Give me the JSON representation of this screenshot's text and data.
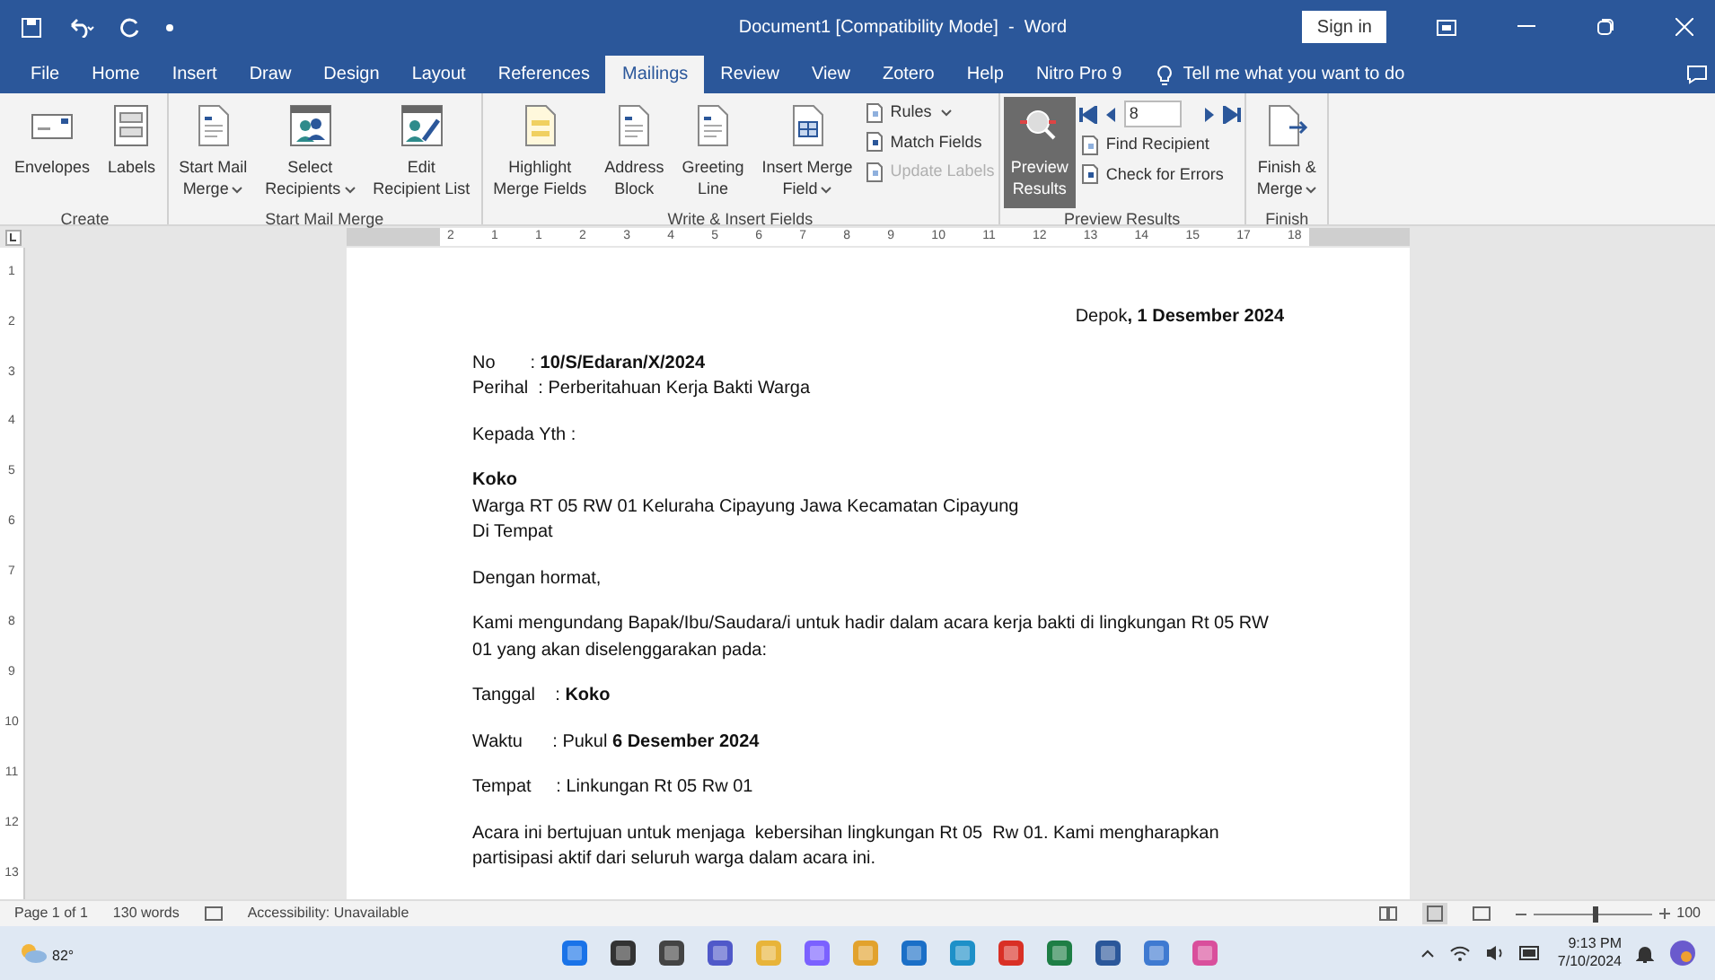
{
  "window": {
    "title": "Document1 [Compatibility Mode]  -  Word",
    "sign_in": "Sign in"
  },
  "tabs": [
    {
      "label": "File",
      "selected": false
    },
    {
      "label": "Home",
      "selected": false
    },
    {
      "label": "Insert",
      "selected": false
    },
    {
      "label": "Draw",
      "selected": false
    },
    {
      "label": "Design",
      "selected": false
    },
    {
      "label": "Layout",
      "selected": false
    },
    {
      "label": "References",
      "selected": false
    },
    {
      "label": "Mailings",
      "selected": true
    },
    {
      "label": "Review",
      "selected": false
    },
    {
      "label": "View",
      "selected": false
    },
    {
      "label": "Zotero",
      "selected": false
    },
    {
      "label": "Help",
      "selected": false
    },
    {
      "label": "Nitro Pro 9",
      "selected": false
    }
  ],
  "tell_me": "Tell me what you want to do",
  "ribbon": [
    {
      "group": "Create",
      "items": [
        {
          "kind": "large",
          "lines": [
            "Envelopes"
          ],
          "dropdown": false,
          "selected": false
        },
        {
          "kind": "large",
          "lines": [
            "Labels"
          ],
          "dropdown": false,
          "selected": false
        }
      ]
    },
    {
      "group": "Start Mail Merge",
      "items": [
        {
          "kind": "large",
          "lines": [
            "Start Mail",
            "Merge"
          ],
          "dropdown": true,
          "selected": false
        },
        {
          "kind": "large",
          "lines": [
            "Select",
            "Recipients"
          ],
          "dropdown": true,
          "selected": false
        },
        {
          "kind": "large",
          "lines": [
            "Edit",
            "Recipient List"
          ],
          "dropdown": false,
          "selected": false
        }
      ]
    },
    {
      "group": "Write & Insert Fields",
      "items": [
        {
          "kind": "large",
          "lines": [
            "Highlight",
            "Merge Fields"
          ],
          "dropdown": false,
          "selected": false
        },
        {
          "kind": "large",
          "lines": [
            "Address",
            "Block"
          ],
          "dropdown": false,
          "selected": false
        },
        {
          "kind": "large",
          "lines": [
            "Greeting",
            "Line"
          ],
          "dropdown": false,
          "selected": false
        },
        {
          "kind": "large",
          "lines": [
            "Insert Merge",
            "Field"
          ],
          "dropdown": true,
          "selected": false
        },
        {
          "kind": "small",
          "entries": [
            {
              "label": "Rules",
              "dropdown": true,
              "disabled": false
            },
            {
              "label": "Match Fields",
              "dropdown": false,
              "disabled": false
            },
            {
              "label": "Update Labels",
              "dropdown": false,
              "disabled": true
            }
          ]
        }
      ]
    },
    {
      "group": "Preview Results",
      "items": [
        {
          "kind": "large",
          "lines": [
            "Preview",
            "Results"
          ],
          "dropdown": false,
          "selected": true
        },
        {
          "kind": "nav",
          "record": "8",
          "entries": [
            {
              "label": "Find Recipient",
              "disabled": false
            },
            {
              "label": "Check for Errors",
              "disabled": false
            }
          ]
        }
      ]
    },
    {
      "group": "Finish",
      "items": [
        {
          "kind": "large",
          "lines": [
            "Finish &",
            "Merge"
          ],
          "dropdown": true,
          "selected": false
        }
      ]
    }
  ],
  "ruler": {
    "horizontal": [
      "2",
      "1",
      "1",
      "2",
      "3",
      "4",
      "5",
      "6",
      "7",
      "8",
      "9",
      "10",
      "11",
      "12",
      "13",
      "14",
      "15",
      "17",
      "18"
    ],
    "vertical": [
      "1",
      "2",
      "3",
      "4",
      "5",
      "6",
      "7",
      "8",
      "9",
      "10",
      "11",
      "12",
      "13"
    ]
  },
  "document": [
    {
      "lines": [
        {
          "kind": "right",
          "text": "Depok**, 1 Desember 2024**"
        }
      ]
    },
    {
      "lines": [
        {
          "kind": "line",
          "text": "No       : **10/S/Edaran/X/2024**"
        },
        {
          "kind": "line",
          "text": "Perihal  : Perberitahuan Kerja Bakti Warga"
        }
      ]
    },
    {
      "lines": [
        {
          "kind": "line",
          "text": "Kepada Yth :"
        }
      ]
    },
    {
      "lines": [
        {
          "kind": "line",
          "text": "**Koko**"
        },
        {
          "kind": "line",
          "text": "Warga RT 05 RW 01 Keluraha Cipayung Jawa Kecamatan Cipayung"
        },
        {
          "kind": "line",
          "text": "Di Tempat"
        }
      ]
    },
    {
      "lines": [
        {
          "kind": "line",
          "text": "Dengan hormat,"
        }
      ]
    },
    {
      "lines": [
        {
          "kind": "para",
          "text": "Kami mengundang Bapak/Ibu/Saudara/i untuk hadir dalam acara kerja bakti di lingkungan Rt 05 RW 01 yang akan diselenggarakan pada:"
        }
      ]
    },
    {
      "lines": [
        {
          "kind": "line",
          "text": "Tanggal    : **Koko**"
        }
      ]
    },
    {
      "lines": [
        {
          "kind": "line",
          "text": "Waktu      : Pukul **6 Desember 2024**"
        }
      ]
    },
    {
      "lines": [
        {
          "kind": "line",
          "text": "Tempat     : Linkungan Rt 05 Rw 01"
        }
      ]
    },
    {
      "lines": [
        {
          "kind": "para",
          "text": "Acara ini bertujuan untuk menjaga  kebersihan lingkungan Rt 05  Rw 01. Kami mengharapkan partisipasi aktif dari seluruh warga dalam acara ini."
        }
      ]
    }
  ],
  "status_bar": {
    "page": "Page 1 of 1",
    "words": "130 words",
    "accessibility": "Accessibility: Unavailable",
    "zoom": "100",
    "zoom_slider": {
      "level": 0.5
    }
  },
  "taskbar": {
    "weather": "82°",
    "time": "9:13 PM",
    "date": "7/10/2024"
  }
}
